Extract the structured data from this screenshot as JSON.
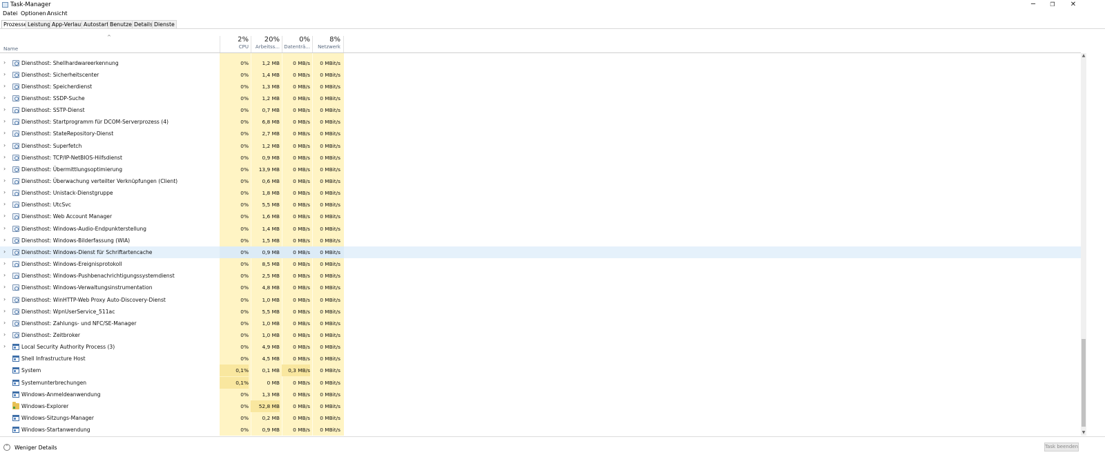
{
  "window": {
    "title": "Task-Manager",
    "minimize": "─",
    "restore": "❐",
    "close": "✕"
  },
  "menu": [
    "Datei",
    "Optionen",
    "Ansicht"
  ],
  "tabs": [
    "Prozesse",
    "Leistung",
    "App-Verlauf",
    "Autostart",
    "Benutzer",
    "Details",
    "Dienste"
  ],
  "active_tab": "Prozesse",
  "header": {
    "sort_glyph": "^",
    "name": "Name",
    "cpu_pct": "2%",
    "cpu_label": "CPU",
    "mem_pct": "20%",
    "mem_label": "Arbeitss...",
    "disk_pct": "0%",
    "disk_label": "Datenträ...",
    "net_pct": "8%",
    "net_label": "Netzwerk"
  },
  "colors": {
    "usage_bg": "#fff4c4",
    "usage_hot": "#f9e79f",
    "selected": "#e5f1fb"
  },
  "rows": [
    {
      "name": "Diensthost: Shellhardwareerkennung",
      "cpu": "0%",
      "mem": "1,2 MB",
      "disk": "0 MB/s",
      "net": "0 MBit/s",
      "icon": "gear-icon",
      "expand": true
    },
    {
      "name": "Diensthost: Sicherheitscenter",
      "cpu": "0%",
      "mem": "1,4 MB",
      "disk": "0 MB/s",
      "net": "0 MBit/s",
      "icon": "gear-icon",
      "expand": true
    },
    {
      "name": "Diensthost: Speicherdienst",
      "cpu": "0%",
      "mem": "1,3 MB",
      "disk": "0 MB/s",
      "net": "0 MBit/s",
      "icon": "gear-icon",
      "expand": true
    },
    {
      "name": "Diensthost: SSDP-Suche",
      "cpu": "0%",
      "mem": "1,2 MB",
      "disk": "0 MB/s",
      "net": "0 MBit/s",
      "icon": "gear-icon",
      "expand": true
    },
    {
      "name": "Diensthost: SSTP-Dienst",
      "cpu": "0%",
      "mem": "0,7 MB",
      "disk": "0 MB/s",
      "net": "0 MBit/s",
      "icon": "gear-icon",
      "expand": true
    },
    {
      "name": "Diensthost: Startprogramm für DCOM-Serverprozess (4)",
      "cpu": "0%",
      "mem": "6,8 MB",
      "disk": "0 MB/s",
      "net": "0 MBit/s",
      "icon": "gear-icon",
      "expand": true
    },
    {
      "name": "Diensthost: StateRepository-Dienst",
      "cpu": "0%",
      "mem": "2,7 MB",
      "disk": "0 MB/s",
      "net": "0 MBit/s",
      "icon": "gear-icon",
      "expand": true
    },
    {
      "name": "Diensthost: Superfetch",
      "cpu": "0%",
      "mem": "1,2 MB",
      "disk": "0 MB/s",
      "net": "0 MBit/s",
      "icon": "gear-icon",
      "expand": true
    },
    {
      "name": "Diensthost: TCP/IP-NetBIOS-Hilfsdienst",
      "cpu": "0%",
      "mem": "0,9 MB",
      "disk": "0 MB/s",
      "net": "0 MBit/s",
      "icon": "gear-icon",
      "expand": true
    },
    {
      "name": "Diensthost: Übermittlungsoptimierung",
      "cpu": "0%",
      "mem": "13,9 MB",
      "disk": "0 MB/s",
      "net": "0 MBit/s",
      "icon": "gear-icon",
      "expand": true
    },
    {
      "name": "Diensthost: Überwachung verteilter Verknüpfungen (Client)",
      "cpu": "0%",
      "mem": "0,6 MB",
      "disk": "0 MB/s",
      "net": "0 MBit/s",
      "icon": "gear-icon",
      "expand": true
    },
    {
      "name": "Diensthost: Unistack-Dienstgruppe",
      "cpu": "0%",
      "mem": "1,8 MB",
      "disk": "0 MB/s",
      "net": "0 MBit/s",
      "icon": "gear-icon",
      "expand": true
    },
    {
      "name": "Diensthost: UtcSvc",
      "cpu": "0%",
      "mem": "5,5 MB",
      "disk": "0 MB/s",
      "net": "0 MBit/s",
      "icon": "gear-icon",
      "expand": true
    },
    {
      "name": "Diensthost: Web Account Manager",
      "cpu": "0%",
      "mem": "1,6 MB",
      "disk": "0 MB/s",
      "net": "0 MBit/s",
      "icon": "gear-icon",
      "expand": true
    },
    {
      "name": "Diensthost: Windows-Audio-Endpunkterstellung",
      "cpu": "0%",
      "mem": "1,4 MB",
      "disk": "0 MB/s",
      "net": "0 MBit/s",
      "icon": "gear-icon",
      "expand": true
    },
    {
      "name": "Diensthost: Windows-Bilderfassung (WIA)",
      "cpu": "0%",
      "mem": "1,5 MB",
      "disk": "0 MB/s",
      "net": "0 MBit/s",
      "icon": "gear-icon",
      "expand": true
    },
    {
      "name": "Diensthost: Windows-Dienst für Schriftartencache",
      "cpu": "0%",
      "mem": "0,9 MB",
      "disk": "0 MB/s",
      "net": "0 MBit/s",
      "icon": "gear-icon",
      "expand": true,
      "selected": true
    },
    {
      "name": "Diensthost: Windows-Ereignisprotokoll",
      "cpu": "0%",
      "mem": "8,5 MB",
      "disk": "0 MB/s",
      "net": "0 MBit/s",
      "icon": "gear-icon",
      "expand": true
    },
    {
      "name": "Diensthost: Windows-Pushbenachrichtigungssystemdienst",
      "cpu": "0%",
      "mem": "2,5 MB",
      "disk": "0 MB/s",
      "net": "0 MBit/s",
      "icon": "gear-icon",
      "expand": true
    },
    {
      "name": "Diensthost: Windows-Verwaltungsinstrumentation",
      "cpu": "0%",
      "mem": "4,8 MB",
      "disk": "0 MB/s",
      "net": "0 MBit/s",
      "icon": "gear-icon",
      "expand": true
    },
    {
      "name": "Diensthost: WinHTTP-Web Proxy Auto-Discovery-Dienst",
      "cpu": "0%",
      "mem": "1,0 MB",
      "disk": "0 MB/s",
      "net": "0 MBit/s",
      "icon": "gear-icon",
      "expand": true
    },
    {
      "name": "Diensthost: WpnUserService_511ac",
      "cpu": "0%",
      "mem": "5,5 MB",
      "disk": "0 MB/s",
      "net": "0 MBit/s",
      "icon": "gear-icon",
      "expand": true
    },
    {
      "name": "Diensthost: Zahlungs- und NFC/SE-Manager",
      "cpu": "0%",
      "mem": "1,0 MB",
      "disk": "0 MB/s",
      "net": "0 MBit/s",
      "icon": "gear-icon",
      "expand": true
    },
    {
      "name": "Diensthost: Zeitbroker",
      "cpu": "0%",
      "mem": "1,0 MB",
      "disk": "0 MB/s",
      "net": "0 MBit/s",
      "icon": "gear-icon",
      "expand": true
    },
    {
      "name": "Local Security Authority Process (3)",
      "cpu": "0%",
      "mem": "4,9 MB",
      "disk": "0 MB/s",
      "net": "0 MBit/s",
      "icon": "window-icon",
      "expand": true
    },
    {
      "name": "Shell Infrastructure Host",
      "cpu": "0%",
      "mem": "4,5 MB",
      "disk": "0 MB/s",
      "net": "0 MBit/s",
      "icon": "window-icon",
      "expand": false
    },
    {
      "name": "System",
      "cpu": "0,1%",
      "mem": "0,1 MB",
      "disk": "0,3 MB/s",
      "net": "0 MBit/s",
      "icon": "window-icon",
      "expand": false,
      "cpu_hot": true,
      "disk_hot": true
    },
    {
      "name": "Systemunterbrechungen",
      "cpu": "0,1%",
      "mem": "0 MB",
      "disk": "0 MB/s",
      "net": "0 MBit/s",
      "icon": "window-icon",
      "expand": false,
      "cpu_hot": true
    },
    {
      "name": "Windows-Anmeldeanwendung",
      "cpu": "0%",
      "mem": "1,3 MB",
      "disk": "0 MB/s",
      "net": "0 MBit/s",
      "icon": "window-icon",
      "expand": false
    },
    {
      "name": "Windows-Explorer",
      "cpu": "0%",
      "mem": "52,8 MB",
      "disk": "0 MB/s",
      "net": "0 MBit/s",
      "icon": "folder-icon",
      "expand": false,
      "mem_hot": true
    },
    {
      "name": "Windows-Sitzungs-Manager",
      "cpu": "0%",
      "mem": "0,2 MB",
      "disk": "0 MB/s",
      "net": "0 MBit/s",
      "icon": "window-icon",
      "expand": false
    },
    {
      "name": "Windows-Startanwendung",
      "cpu": "0%",
      "mem": "0,9 MB",
      "disk": "0 MB/s",
      "net": "0 MBit/s",
      "icon": "window-icon",
      "expand": false
    }
  ],
  "footer": {
    "less_details": "Weniger Details",
    "end_task": "Task beenden"
  }
}
